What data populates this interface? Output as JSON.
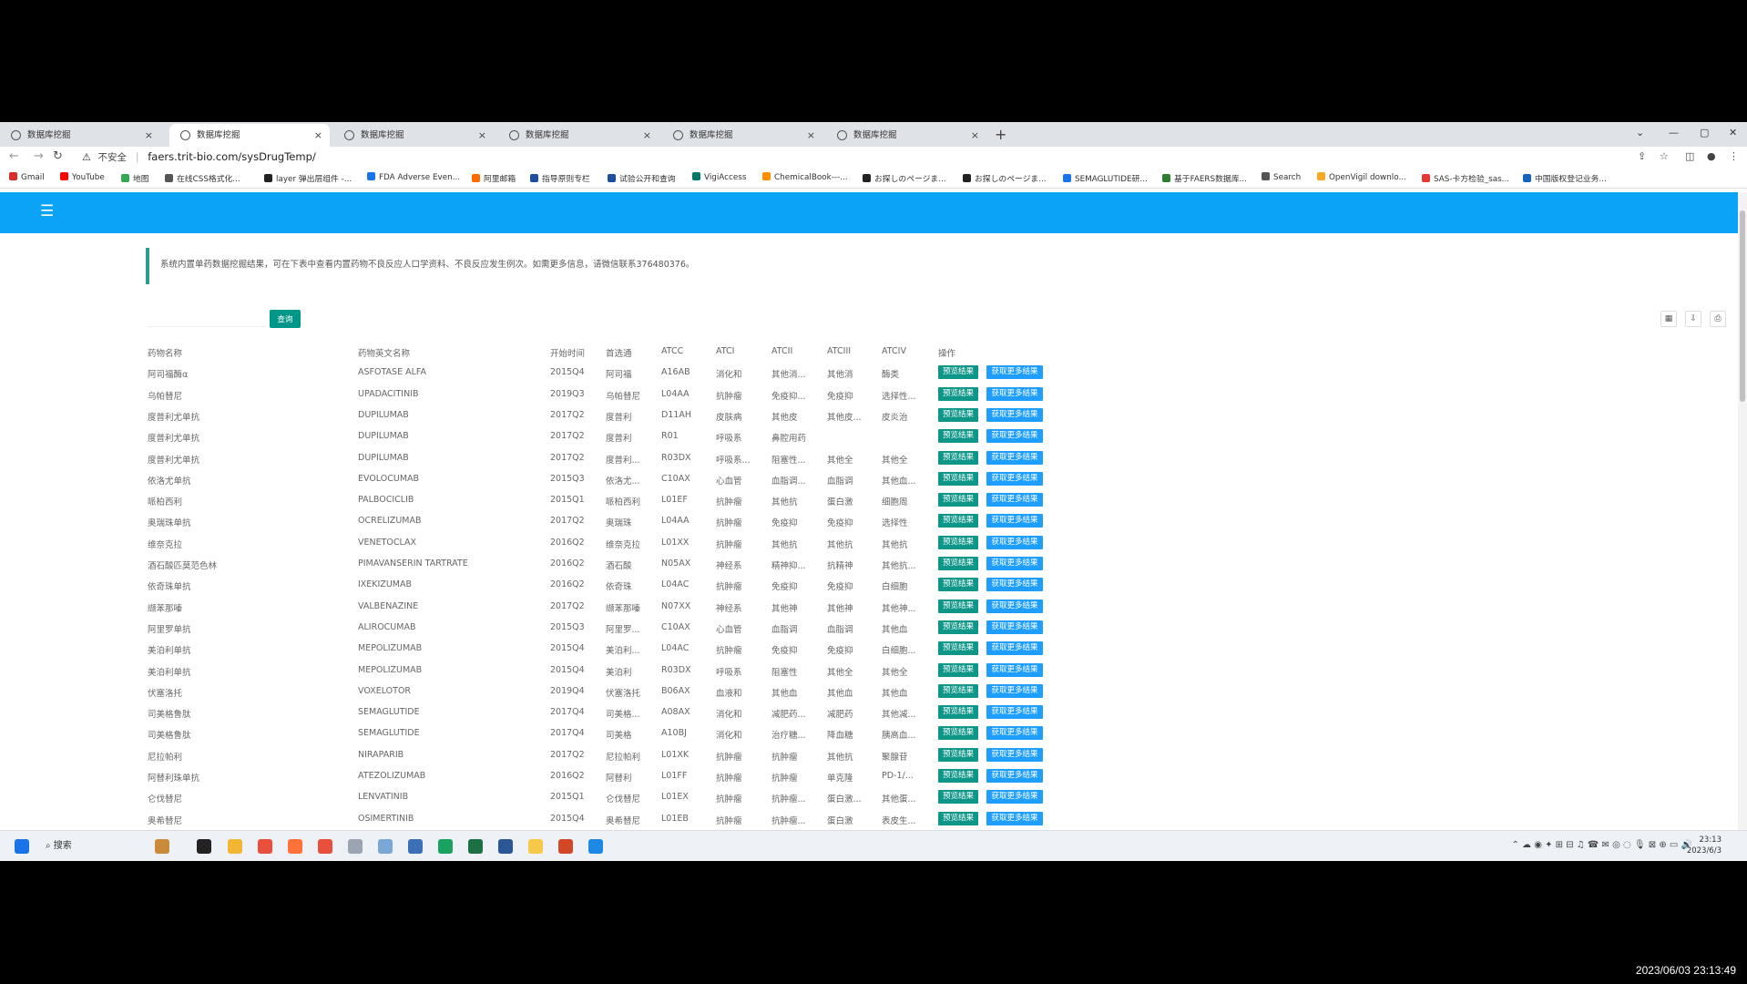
{
  "browser": {
    "tabs": [
      {
        "title": "数据库挖掘",
        "active": false
      },
      {
        "title": "数据库挖掘",
        "active": true
      },
      {
        "title": "数据库挖掘",
        "active": false
      },
      {
        "title": "数据库挖掘",
        "active": false
      },
      {
        "title": "数据库挖掘",
        "active": false
      },
      {
        "title": "数据库挖掘",
        "active": false
      }
    ],
    "new_tab": "+",
    "security_label": "不安全",
    "url": "faers.trit-bio.com/sysDrugTemp/",
    "bookmarks": [
      {
        "label": "Gmail",
        "color": "#d93025"
      },
      {
        "label": "YouTube",
        "color": "#ff0000"
      },
      {
        "label": "地图",
        "color": "#34a853"
      },
      {
        "label": "在线CSS格式化...",
        "color": "#555555"
      },
      {
        "label": "layer 弹出层组件 -...",
        "color": "#222222"
      },
      {
        "label": "FDA Adverse Even...",
        "color": "#1a73e8"
      },
      {
        "label": "阿里邮箱",
        "color": "#ff6a00"
      },
      {
        "label": "指导原则专栏",
        "color": "#1f4e9c"
      },
      {
        "label": "试验公开和查询",
        "color": "#1f4e9c"
      },
      {
        "label": "VigiAccess",
        "color": "#00796b"
      },
      {
        "label": "ChemicalBook---...",
        "color": "#ff8f00"
      },
      {
        "label": "お探しのページま...",
        "color": "#222222"
      },
      {
        "label": "お探しのページま...",
        "color": "#222222"
      },
      {
        "label": "SEMAGLUTIDE研...",
        "color": "#1a73e8"
      },
      {
        "label": "基于FAERS数据库...",
        "color": "#2e7d32"
      },
      {
        "label": "Search",
        "color": "#555555"
      },
      {
        "label": "OpenVigil downlo...",
        "color": "#f9a825"
      },
      {
        "label": "SAS-卡方检验_sas...",
        "color": "#e53935"
      },
      {
        "label": "中国版权登记业务...",
        "color": "#1565c0"
      }
    ]
  },
  "page": {
    "notice": "系统内置单药数据挖掘结果，可在下表中查看内置药物不良反应人口学资料、不良反应发生例次。如需更多信息，请微信联系376480376。",
    "search_placeholder": "",
    "search_button": "查询",
    "columns": [
      "药物名称",
      "药物英文名称",
      "开始时间",
      "首选通",
      "ATCC",
      "ATCI",
      "ATCII",
      "ATCIII",
      "ATCIV",
      "操作"
    ],
    "action_primary": "预览结果",
    "action_secondary": "获取更多结果",
    "rows": [
      [
        "阿司福酶α",
        "ASFOTASE ALFA",
        "2015Q4",
        "阿司福",
        "A16AB",
        "消化和",
        "其他消...",
        "其他消",
        "酶类"
      ],
      [
        "乌帕替尼",
        "UPADACITINIB",
        "2019Q3",
        "乌帕替尼",
        "L04AA",
        "抗肿瘤",
        "免疫抑...",
        "免疫抑",
        "选择性..."
      ],
      [
        "度普利尤单抗",
        "DUPILUMAB",
        "2017Q2",
        "度普利",
        "D11AH",
        "皮肤病",
        "其他皮",
        "其他皮...",
        "皮炎治"
      ],
      [
        "度普利尤单抗",
        "DUPILUMAB",
        "2017Q2",
        "度普利",
        "R01",
        "呼吸系",
        "鼻腔用药",
        "",
        ""
      ],
      [
        "度普利尤单抗",
        "DUPILUMAB",
        "2017Q2",
        "度普利...",
        "R03DX",
        "呼吸系...",
        "阻塞性...",
        "其他全",
        "其他全"
      ],
      [
        "依洛尤单抗",
        "EVOLOCUMAB",
        "2015Q3",
        "依洛尤...",
        "C10AX",
        "心血管",
        "血脂调...",
        "血脂调",
        "其他血..."
      ],
      [
        "哌柏西利",
        "PALBOCICLIB",
        "2015Q1",
        "哌柏西利",
        "L01EF",
        "抗肿瘤",
        "其他抗",
        "蛋白激",
        "细胞周"
      ],
      [
        "奥瑞珠单抗",
        "OCRELIZUMAB",
        "2017Q2",
        "奥瑞珠",
        "L04AA",
        "抗肿瘤",
        "免疫抑",
        "免疫抑",
        "选择性"
      ],
      [
        "维奈克拉",
        "VENETOCLAX",
        "2016Q2",
        "维奈克拉",
        "L01XX",
        "抗肿瘤",
        "其他抗",
        "其他抗",
        "其他抗"
      ],
      [
        "酒石酸匹莫范色林",
        "PIMAVANSERIN TARTRATE",
        "2016Q2",
        "酒石酸",
        "N05AX",
        "神经系",
        "精神抑...",
        "抗精神",
        "其他抗..."
      ],
      [
        "依奇珠单抗",
        "IXEKIZUMAB",
        "2016Q2",
        "依奇珠",
        "L04AC",
        "抗肿瘤",
        "免疫抑",
        "免疫抑",
        "白细胞"
      ],
      [
        "缬苯那嗪",
        "VALBENAZINE",
        "2017Q2",
        "缬苯那嗪",
        "N07XX",
        "神经系",
        "其他神",
        "其他神",
        "其他神..."
      ],
      [
        "阿里罗单抗",
        "ALIROCUMAB",
        "2015Q3",
        "阿里罗...",
        "C10AX",
        "心血管",
        "血脂调",
        "血脂调",
        "其他血"
      ],
      [
        "美泊利单抗",
        "MEPOLIZUMAB",
        "2015Q4",
        "美泊利...",
        "L04AC",
        "抗肿瘤",
        "免疫抑",
        "免疫抑",
        "白细胞..."
      ],
      [
        "美泊利单抗",
        "MEPOLIZUMAB",
        "2015Q4",
        "美泊利",
        "R03DX",
        "呼吸系",
        "阻塞性",
        "其他全",
        "其他全"
      ],
      [
        "伏塞洛托",
        "VOXELOTOR",
        "2019Q4",
        "伏塞洛托",
        "B06AX",
        "血液和",
        "其他血",
        "其他血",
        "其他血"
      ],
      [
        "司美格鲁肽",
        "SEMAGLUTIDE",
        "2017Q4",
        "司美格...",
        "A08AX",
        "消化和",
        "减肥药...",
        "减肥药",
        "其他减..."
      ],
      [
        "司美格鲁肽",
        "SEMAGLUTIDE",
        "2017Q4",
        "司美格",
        "A10BJ",
        "消化和",
        "治疗糖...",
        "降血糖",
        "胰高血..."
      ],
      [
        "尼拉帕利",
        "NIRAPARIB",
        "2017Q2",
        "尼拉帕利",
        "L01XK",
        "抗肿瘤",
        "抗肿瘤",
        "其他抗",
        "聚腺苷"
      ],
      [
        "阿替利珠单抗",
        "ATEZOLIZUMAB",
        "2016Q2",
        "阿替利",
        "L01FF",
        "抗肿瘤",
        "抗肿瘤",
        "单克隆",
        "PD-1/..."
      ],
      [
        "仑伐替尼",
        "LENVATINIB",
        "2015Q1",
        "仑伐替尼",
        "L01EX",
        "抗肿瘤",
        "抗肿瘤...",
        "蛋白激...",
        "其他蛋..."
      ],
      [
        "奥希替尼",
        "OSIMERTINIB",
        "2015Q4",
        "奥希替尼",
        "L01EB",
        "抗肿瘤",
        "抗肿瘤...",
        "蛋白激",
        "表皮生..."
      ]
    ]
  },
  "taskbar": {
    "search_label": "搜索",
    "time": "23:13",
    "date": "2023/6/3"
  },
  "overlay_timestamp": "2023/06/03 23:13:49"
}
